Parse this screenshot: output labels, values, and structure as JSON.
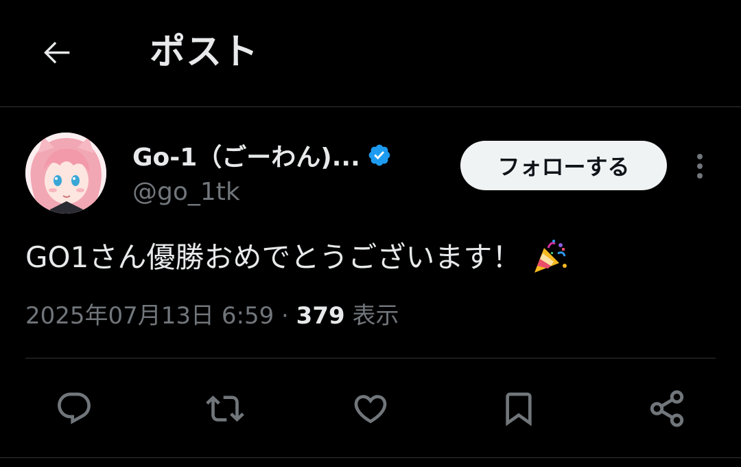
{
  "header": {
    "title": "ポスト",
    "back_icon": "arrow-left-icon"
  },
  "author": {
    "display_name": "Go-1（ごーわん)...",
    "handle": "@go_1tk",
    "verified_icon": "verified-badge-icon",
    "verified_color": "#1d9bf0",
    "follow_label": "フォローする",
    "more_icon": "more-vertical-icon"
  },
  "post": {
    "text": "GO1さん優勝おめでとうございます！",
    "emoji_icon": "party-popper-icon",
    "timestamp": "2025年07月13日 6:59",
    "separator": " · ",
    "views_count": "379",
    "views_label": " 表示"
  },
  "actions": {
    "reply_icon": "reply-icon",
    "repost_icon": "repost-icon",
    "like_icon": "heart-icon",
    "bookmark_icon": "bookmark-icon",
    "share_icon": "share-icon"
  },
  "colors": {
    "background": "#000000",
    "text_primary": "#e7e9ea",
    "text_secondary": "#71767b",
    "divider": "#2f3336",
    "follow_bg": "#eff3f4"
  }
}
